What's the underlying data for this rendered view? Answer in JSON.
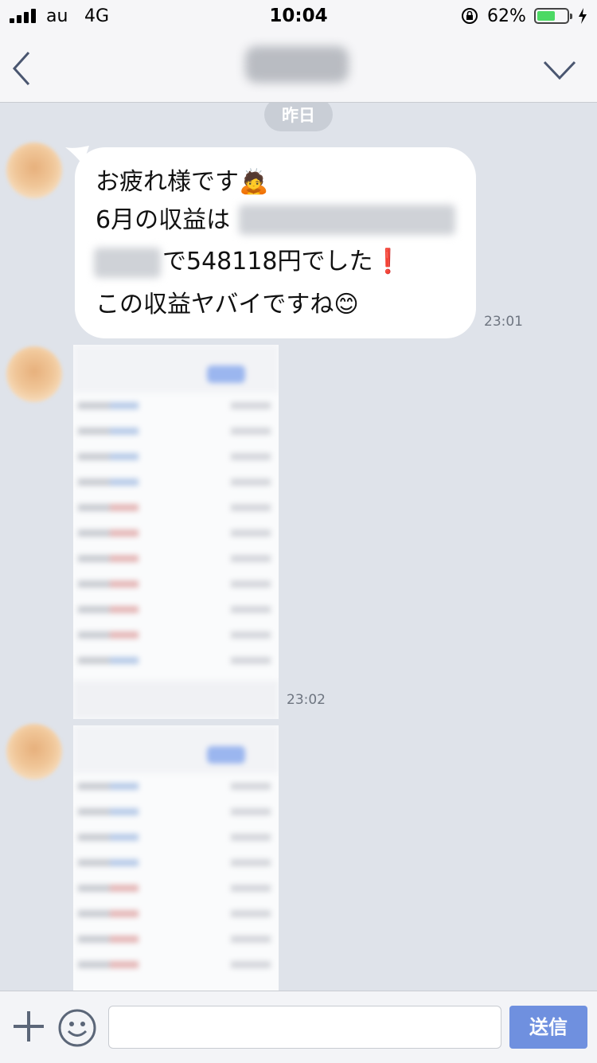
{
  "status_bar": {
    "carrier": "au",
    "network": "4G",
    "time": "10:04",
    "battery_percent": "62%",
    "battery_level": 0.62
  },
  "nav": {
    "back_icon": "chevron-left-icon",
    "menu_icon": "chevron-down-icon"
  },
  "chat": {
    "date_label": "昨日",
    "message": {
      "line1": "お疲れ様です🙇",
      "line2": "6月の収益は",
      "line3": "で548118円でした❗",
      "line4": "この収益ヤバイですね😊",
      "time": "23:01"
    },
    "image_message_1": {
      "time": "23:02"
    }
  },
  "input_bar": {
    "plus_icon": "plus-icon",
    "emoji_icon": "smiley-icon",
    "text_value": "",
    "send_label": "送信"
  },
  "colors": {
    "chat_background": "#dfe3ea",
    "send_button": "#6f90df",
    "battery_fill": "#4cd964"
  }
}
